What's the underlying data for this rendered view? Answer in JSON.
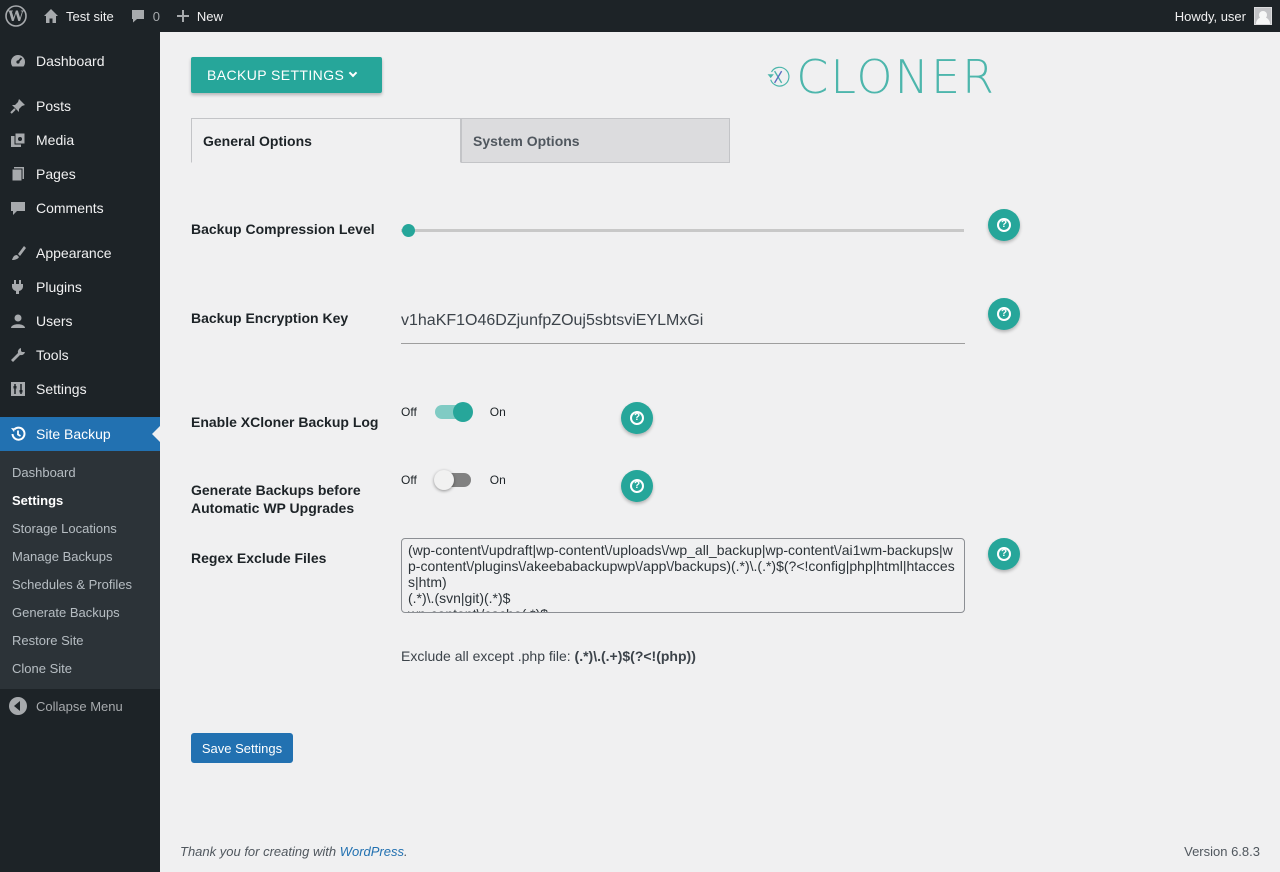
{
  "adminbar": {
    "site_name": "Test site",
    "comments_count": "0",
    "new_label": "New",
    "greeting": "Howdy, user"
  },
  "sidebar": {
    "items": [
      {
        "label": "Dashboard",
        "icon": "dashboard-icon"
      },
      {
        "label": "Posts",
        "icon": "pin-icon"
      },
      {
        "label": "Media",
        "icon": "media-icon"
      },
      {
        "label": "Pages",
        "icon": "pages-icon"
      },
      {
        "label": "Comments",
        "icon": "comment-icon"
      },
      {
        "label": "Appearance",
        "icon": "brush-icon"
      },
      {
        "label": "Plugins",
        "icon": "plug-icon"
      },
      {
        "label": "Users",
        "icon": "user-icon"
      },
      {
        "label": "Tools",
        "icon": "wrench-icon"
      },
      {
        "label": "Settings",
        "icon": "settings-icon"
      },
      {
        "label": "Site Backup",
        "icon": "backup-icon"
      }
    ],
    "submenu": [
      "Dashboard",
      "Settings",
      "Storage Locations",
      "Manage Backups",
      "Schedules & Profiles",
      "Generate Backups",
      "Restore Site",
      "Clone Site"
    ],
    "collapse_label": "Collapse Menu"
  },
  "header": {
    "backup_settings_label": "BACKUP SETTINGS",
    "logo_text": "CLONER"
  },
  "tabs": [
    "General Options",
    "System Options"
  ],
  "form": {
    "compression_label": "Backup Compression Level",
    "compression_value": 0,
    "encryption_label": "Backup Encryption Key",
    "encryption_value": "v1haKF1O46DZjunfpZOuj5sbtsviEYLMxGi",
    "log_label": "Enable XCloner Backup Log",
    "log_enabled": true,
    "upgrades_label": "Generate Backups before Automatic WP Upgrades",
    "upgrades_enabled": false,
    "switch_off": "Off",
    "switch_on": "On",
    "regex_label": "Regex Exclude Files",
    "regex_value": "(wp-content\\/updraft|wp-content\\/uploads\\/wp_all_backup|wp-content\\/ai1wm-backups|wp-content\\/plugins\\/akeebabackupwp\\/app\\/backups)(.*)\\.(.*)$(?<!config|php|html|htaccess|htm)\n(.*)\\.(svn|git)(.*)$\nwp-content\\/cache(.*)$",
    "regex_hint_prefix": "Exclude all except .php file:",
    "regex_hint_code": "(.*)\\.(.+)$(?<!(php))",
    "save_label": "Save Settings"
  },
  "footer": {
    "thanks_prefix": "Thank you for creating with",
    "wordpress_link": "WordPress",
    "thanks_suffix": ".",
    "version": "Version 6.8.3"
  },
  "colors": {
    "accent": "#26a69a",
    "wp_blue": "#2271b1",
    "sidebar_bg": "#1d2327"
  }
}
